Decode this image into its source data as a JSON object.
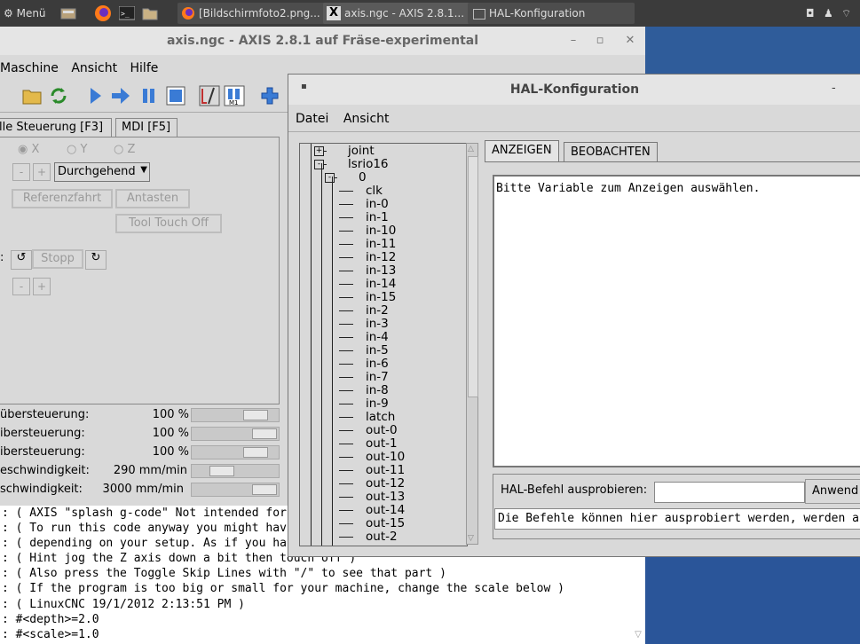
{
  "taskbar": {
    "menu_label": "Menü",
    "tasks": [
      {
        "label": "[Bildschirmfoto2.png..."
      },
      {
        "label": "axis.ngc - AXIS 2.8.1..."
      },
      {
        "label": "HAL-Konfiguration"
      }
    ]
  },
  "axis": {
    "title": "axis.ngc - AXIS 2.8.1 auf  Fräse-experimental",
    "window_buttons": [
      "–",
      "▫",
      "✕"
    ],
    "menu": [
      "Maschine",
      "Ansicht",
      "Hilfe"
    ],
    "tabs": [
      "lle Steuerung [F3]",
      "MDI [F5]"
    ],
    "axes": [
      "X",
      "Y",
      "Z"
    ],
    "jog_mode": "Durchgehend",
    "minus": "-",
    "plus": "+",
    "referenzfahrt": "Referenzfahrt",
    "antasten": "Antasten",
    "tool_touch_off": "Tool Touch Off",
    "spindle_stop": "Stopp",
    "colon": ":",
    "overrides": [
      {
        "label": "übersteuerung:",
        "value": "100 %",
        "level": 0.85
      },
      {
        "label": "ibersteuerung:",
        "value": "100 %",
        "level": 0.85
      },
      {
        "label": "ibersteuerung:",
        "value": "100 %",
        "level": 0.85
      },
      {
        "label": "eschwindigkeit:",
        "value": "290 mm/min",
        "level": 0.35
      },
      {
        "label": "schwindigkeit:",
        "value": "3000 mm/min",
        "level": 0.85
      }
    ],
    "gcode": [
      ": ( AXIS \"splash g-code\" Not intended for",
      ": ( To run this code anyway you might hav",
      ": ( depending on your setup. As if you ha",
      ": ( Hint jog the Z axis down a bit then touch off )",
      ": ( Also press the Toggle Skip Lines with \"/\" to see that part )",
      ": ( If the program is too big or small for your machine, change the scale below )",
      ": ( LinuxCNC 19/1/2012 2:13:51 PM )",
      ": #<depth>=2.0",
      ": #<scale>=1.0"
    ]
  },
  "hal": {
    "title": "HAL-Konfiguration",
    "minimize": "-",
    "menu": [
      "Datei",
      "Ansicht"
    ],
    "tree": [
      {
        "label": "joint",
        "level": 1,
        "expander": "+"
      },
      {
        "label": "lsrio16",
        "level": 1,
        "expander": "-"
      },
      {
        "label": "0",
        "level": 2,
        "expander": "-"
      },
      {
        "label": "clk",
        "level": 3
      },
      {
        "label": "in-0",
        "level": 3
      },
      {
        "label": "in-1",
        "level": 3
      },
      {
        "label": "in-10",
        "level": 3
      },
      {
        "label": "in-11",
        "level": 3
      },
      {
        "label": "in-12",
        "level": 3
      },
      {
        "label": "in-13",
        "level": 3
      },
      {
        "label": "in-14",
        "level": 3
      },
      {
        "label": "in-15",
        "level": 3
      },
      {
        "label": "in-2",
        "level": 3
      },
      {
        "label": "in-3",
        "level": 3
      },
      {
        "label": "in-4",
        "level": 3
      },
      {
        "label": "in-5",
        "level": 3
      },
      {
        "label": "in-6",
        "level": 3
      },
      {
        "label": "in-7",
        "level": 3
      },
      {
        "label": "in-8",
        "level": 3
      },
      {
        "label": "in-9",
        "level": 3
      },
      {
        "label": "latch",
        "level": 3
      },
      {
        "label": "out-0",
        "level": 3
      },
      {
        "label": "out-1",
        "level": 3
      },
      {
        "label": "out-10",
        "level": 3
      },
      {
        "label": "out-11",
        "level": 3
      },
      {
        "label": "out-12",
        "level": 3
      },
      {
        "label": "out-13",
        "level": 3
      },
      {
        "label": "out-14",
        "level": 3
      },
      {
        "label": "out-15",
        "level": 3
      },
      {
        "label": "out-2",
        "level": 3
      }
    ],
    "tabs": [
      "ANZEIGEN",
      "BEOBACHTEN"
    ],
    "show_text": "Bitte Variable zum Anzeigen auswählen.",
    "cmd_label": "HAL-Befehl ausprobieren:",
    "cmd_value": "",
    "cmd_button": "Anwend",
    "cmd_output": "Die Befehle können hier ausprobiert werden, werden a"
  }
}
